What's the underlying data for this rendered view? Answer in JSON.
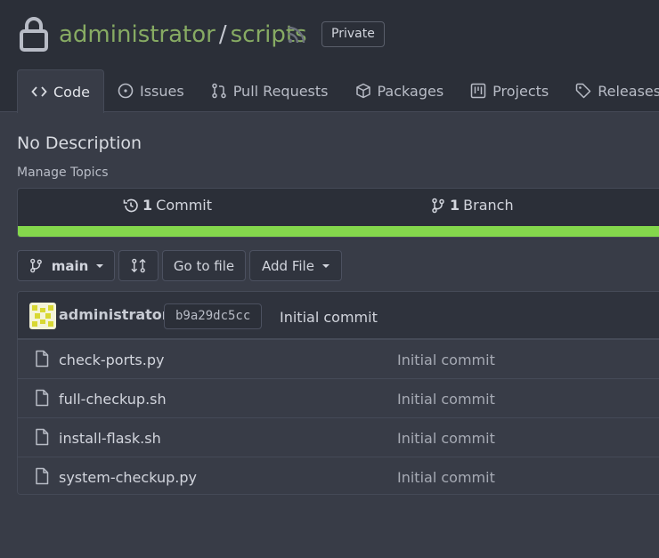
{
  "repo": {
    "owner": "administrator",
    "separator": "/",
    "name": "scripts",
    "visibility": "Private"
  },
  "tabs": [
    {
      "label": "Code",
      "icon": "code-icon",
      "active": true
    },
    {
      "label": "Issues",
      "icon": "issue-icon"
    },
    {
      "label": "Pull Requests",
      "icon": "pull-request-icon"
    },
    {
      "label": "Packages",
      "icon": "package-icon"
    },
    {
      "label": "Projects",
      "icon": "project-icon"
    },
    {
      "label": "Releases",
      "icon": "tag-icon"
    }
  ],
  "description": "No Description",
  "manage_topics": "Manage Topics",
  "stats": {
    "commits_count": "1",
    "commits_label": "Commit",
    "branches_count": "1",
    "branches_label": "Branch"
  },
  "language_bar_color": "#84d74c",
  "toolbar": {
    "branch": "main",
    "go_to_file": "Go to file",
    "add_file": "Add File"
  },
  "latest_commit": {
    "author": "administrator",
    "sha": "b9a29dc5cc",
    "message": "Initial commit"
  },
  "files": [
    {
      "name": "check-ports.py",
      "message": "Initial commit"
    },
    {
      "name": "full-checkup.sh",
      "message": "Initial commit"
    },
    {
      "name": "install-flask.sh",
      "message": "Initial commit"
    },
    {
      "name": "system-checkup.py",
      "message": "Initial commit"
    }
  ],
  "colors": {
    "accent_link": "#87ab63",
    "background": "#383c47",
    "header": "#2b2f38"
  }
}
